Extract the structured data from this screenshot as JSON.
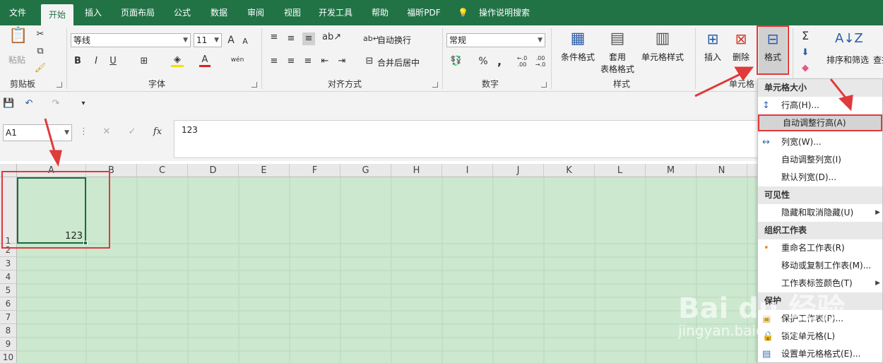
{
  "tabs": [
    "文件",
    "开始",
    "插入",
    "页面布局",
    "公式",
    "数据",
    "审阅",
    "视图",
    "开发工具",
    "帮助",
    "福昕PDF",
    "操作说明搜索"
  ],
  "active_tab": "开始",
  "ribbon": {
    "clipboard": {
      "paste": "粘贴",
      "group": "剪贴板"
    },
    "font": {
      "name": "等线",
      "size": "11",
      "bold": "B",
      "italic": "I",
      "underline": "U",
      "grow": "A",
      "shrink": "A",
      "color_a": "A",
      "wen": "wén",
      "group": "字体"
    },
    "alignment": {
      "wrap": "自动换行",
      "merge": "合并后居中",
      "group": "对齐方式"
    },
    "number": {
      "format": "常规",
      "percent": "%",
      "comma": ",",
      "inc": "←.0\n.00",
      "dec": ".00\n→.0",
      "group": "数字"
    },
    "styles": {
      "cond": "条件格式",
      "table_1": "套用",
      "table_2": "表格格式",
      "cell": "单元格样式",
      "group": "样式"
    },
    "cells": {
      "insert": "插入",
      "delete": "删除",
      "format": "格式",
      "group": "单元格"
    },
    "editing": {
      "sum": "Σ",
      "sort": "排序和筛选",
      "find": "查找"
    }
  },
  "formula_bar": {
    "namebox": "A1",
    "fx": "fx",
    "value": "123"
  },
  "columns": [
    "A",
    "B",
    "C",
    "D",
    "E",
    "F",
    "G",
    "H",
    "I",
    "J",
    "K",
    "L",
    "M",
    "N"
  ],
  "rows": [
    "1",
    "2",
    "3",
    "4",
    "5",
    "6",
    "7",
    "8",
    "9",
    "10"
  ],
  "cell_a1": "123",
  "menu": {
    "h1": "单元格大小",
    "row_height": "行高(H)...",
    "autofit_row": "自动调整行高(A)",
    "col_width": "列宽(W)...",
    "autofit_col": "自动调整列宽(I)",
    "default_width": "默认列宽(D)...",
    "h2": "可见性",
    "hide": "隐藏和取消隐藏(U)",
    "h3": "组织工作表",
    "rename": "重命名工作表(R)",
    "move": "移动或复制工作表(M)...",
    "tabcolor": "工作表标签颜色(T)",
    "h4": "保护",
    "protect": "保护工作表(P)...",
    "lock": "锁定单元格(L)",
    "format_cells": "设置单元格格式(E)..."
  },
  "watermark": {
    "brand": "Bai du 经验",
    "url": "jingyan.baidu.com"
  },
  "colors": {
    "accent": "#217346",
    "grid": "#cce8cf",
    "annotation": "#e03a3a"
  }
}
